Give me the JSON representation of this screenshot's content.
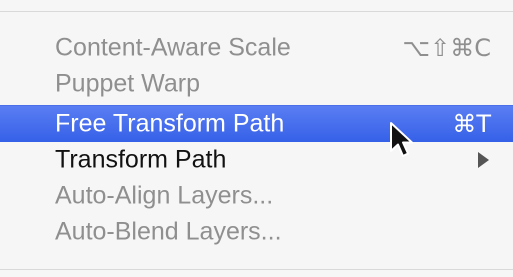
{
  "menu": {
    "items": [
      {
        "label": "Content-Aware Scale",
        "shortcut": "⌥⇧⌘C",
        "state": "disabled"
      },
      {
        "label": "Puppet Warp",
        "shortcut": "",
        "state": "disabled"
      },
      {
        "label": "Free Transform Path",
        "shortcut": "⌘T",
        "state": "highlighted"
      },
      {
        "label": "Transform Path",
        "shortcut": "",
        "state": "enabled",
        "submenu": true
      },
      {
        "label": "Auto-Align Layers...",
        "shortcut": "",
        "state": "disabled"
      },
      {
        "label": "Auto-Blend Layers...",
        "shortcut": "",
        "state": "disabled"
      }
    ]
  },
  "colors": {
    "highlight": "#3a66e9",
    "disabled_text": "#8f8f8f",
    "enabled_text": "#111111",
    "menu_background": "#f6f6f6"
  }
}
